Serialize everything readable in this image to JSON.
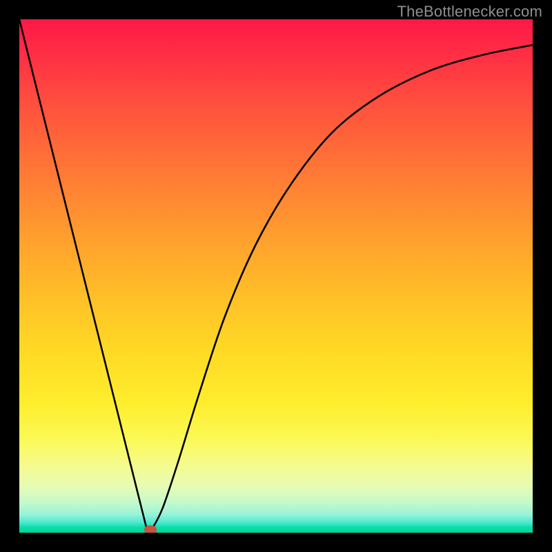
{
  "attribution": "TheBottlenecker.com",
  "chart_data": {
    "type": "line",
    "title": "",
    "xlabel": "",
    "ylabel": "",
    "xlim": [
      0,
      100
    ],
    "ylim": [
      0,
      100
    ],
    "series": [
      {
        "name": "bottleneck-curve",
        "x": [
          0,
          25,
          26,
          28,
          31,
          35,
          40,
          46,
          53,
          61,
          70,
          80,
          90,
          100
        ],
        "values": [
          100,
          0,
          1,
          5,
          14,
          27,
          42,
          56,
          68,
          78,
          85,
          90,
          93,
          95
        ]
      }
    ],
    "marker": {
      "x": 25.5,
      "y": 0
    },
    "colors": {
      "curve": "#000000",
      "marker": "#c8533e",
      "gradient_top": "#ff1846",
      "gradient_bottom": "#00d890"
    }
  }
}
